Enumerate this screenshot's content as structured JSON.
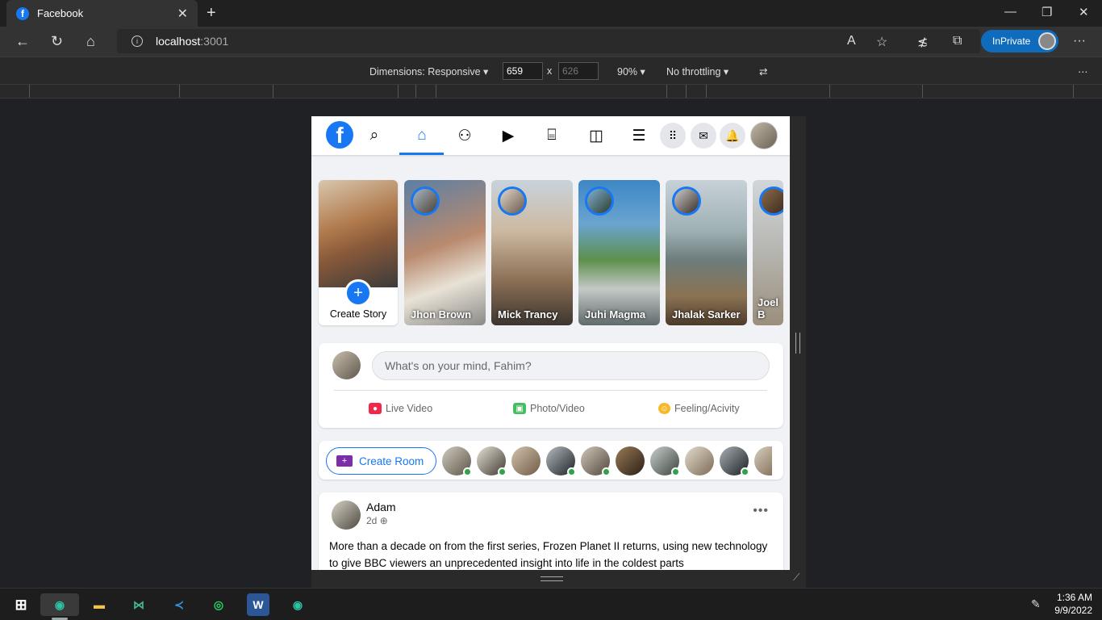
{
  "browser": {
    "tab_title": "Facebook",
    "address_host": "localhost",
    "address_port": ":3001",
    "inprivate_label": "InPrivate"
  },
  "devtools": {
    "dimensions_label": "Dimensions: Responsive",
    "width": "659",
    "height": "626",
    "times": "x",
    "zoom": "90%",
    "throttling": "No throttling"
  },
  "stories": {
    "create_label": "Create Story",
    "items": [
      {
        "name": "Jhon Brown"
      },
      {
        "name": "Mick Trancy"
      },
      {
        "name": "Juhi Magma"
      },
      {
        "name": "Jhalak Sarker"
      },
      {
        "name": "Joel B"
      }
    ]
  },
  "composer": {
    "placeholder": "What's on your mind, Fahim?",
    "live_video": "Live Video",
    "photo_video": "Photo/Video",
    "feeling": "Feeling/Acivity"
  },
  "rooms": {
    "create_room": "Create Room"
  },
  "post": {
    "author": "Adam",
    "time": "2d",
    "text": "More than a decade on from the first series, Frozen Planet II returns, using new technology to give BBC viewers an unprecedented insight into life in the coldest parts"
  },
  "taskbar": {
    "time": "1:36 AM",
    "date": "9/9/2022"
  },
  "colors": {
    "facebook_blue": "#1877f2",
    "online_green": "#31a24c",
    "inprivate_blue": "#0f6cbd"
  }
}
